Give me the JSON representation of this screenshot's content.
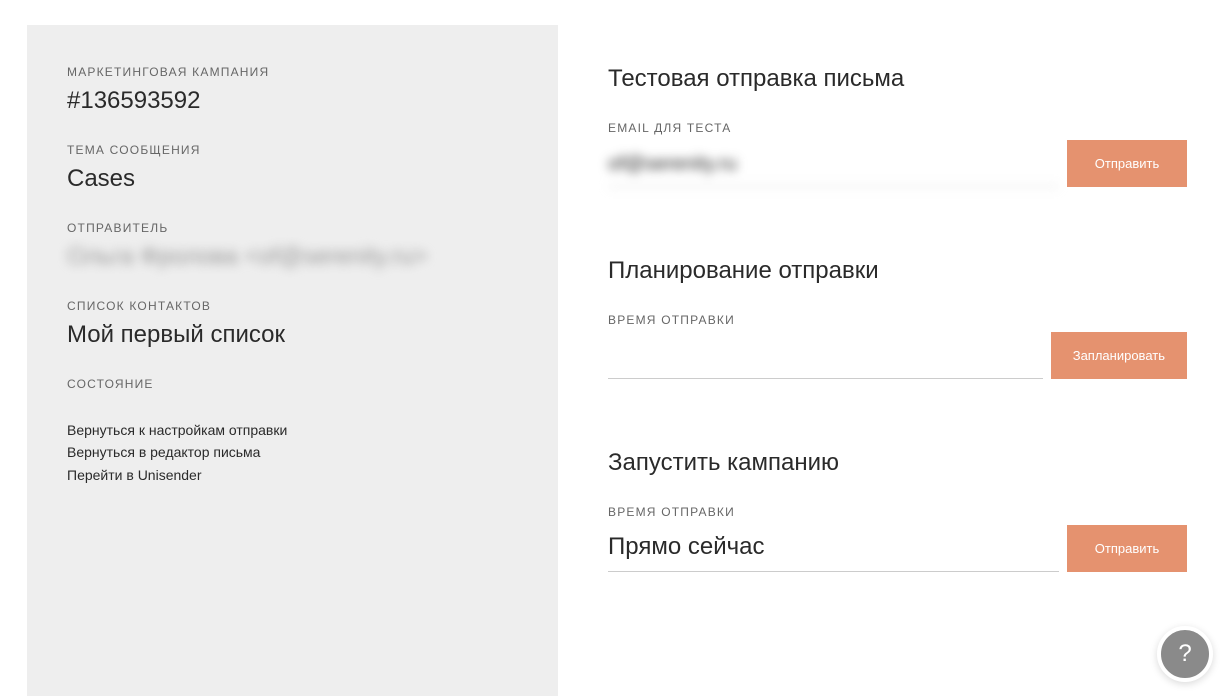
{
  "left": {
    "campaign_label": "МАРКЕТИНГОВАЯ КАМПАНИЯ",
    "campaign_id": "#136593592",
    "subject_label": "ТЕМА СООБЩЕНИЯ",
    "subject_value": "Cases",
    "sender_label": "ОТПРАВИТЕЛЬ",
    "sender_value": "Ольга Фролова <of@serenity.ru>",
    "list_label": "СПИСОК КОНТАКТОВ",
    "list_value": "Мой первый список",
    "status_label": "СОСТОЯНИЕ",
    "link_back_settings": "Вернуться к настройкам отправки",
    "link_back_editor": "Вернуться в редактор письма",
    "link_unisender": "Перейти в Unisender"
  },
  "test": {
    "title": "Тестовая отправка письма",
    "email_label": "EMAIL ДЛЯ ТЕСТА",
    "email_value": "of@serenity.ru",
    "send_btn": "Отправить"
  },
  "schedule": {
    "title": "Планирование отправки",
    "time_label": "ВРЕМЯ ОТПРАВКИ",
    "schedule_btn": "Запланировать"
  },
  "launch": {
    "title": "Запустить кампанию",
    "time_label": "ВРЕМЯ ОТПРАВКИ",
    "time_value": "Прямо сейчас",
    "send_btn": "Отправить"
  },
  "help_icon": "?"
}
